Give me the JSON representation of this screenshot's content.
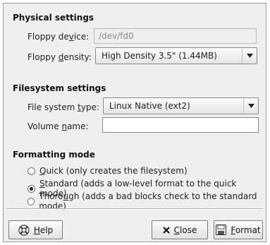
{
  "physical": {
    "title": "Physical settings",
    "device_label_pre": "Floppy de",
    "device_label_key": "v",
    "device_label_post": "ice:",
    "device_value": "/dev/fd0",
    "density_label_pre": "Floppy ",
    "density_label_key": "d",
    "density_label_post": "ensity:",
    "density_value": "High Density 3.5\" (1.44MB)"
  },
  "filesystem": {
    "title": "Filesystem settings",
    "type_label_pre": "File system ",
    "type_label_key": "t",
    "type_label_post": "ype:",
    "type_value": "Linux Native (ext2)",
    "volume_label_pre": "Volume ",
    "volume_label_key": "n",
    "volume_label_post": "ame:",
    "volume_value": ""
  },
  "formatting": {
    "title": "Formatting mode",
    "options": [
      {
        "key": "Q",
        "rest": "uick (only creates the filesystem)",
        "selected": false
      },
      {
        "key": "S",
        "rest": "tandard (adds a low-level format to the quick mode)",
        "selected": true
      },
      {
        "pre": "Thoro",
        "key": "u",
        "rest": "gh (adds a bad blocks check to the standard mode)",
        "selected": false
      }
    ]
  },
  "buttons": {
    "help_key": "H",
    "help_rest": "elp",
    "close_key": "C",
    "close_rest": "lose",
    "format_key": "F",
    "format_rest": "ormat"
  },
  "icons": {
    "help": "help-icon",
    "close": "close-x-icon",
    "format": "floppy-disk-icon",
    "combo_arrow": "chevron-down-icon"
  }
}
